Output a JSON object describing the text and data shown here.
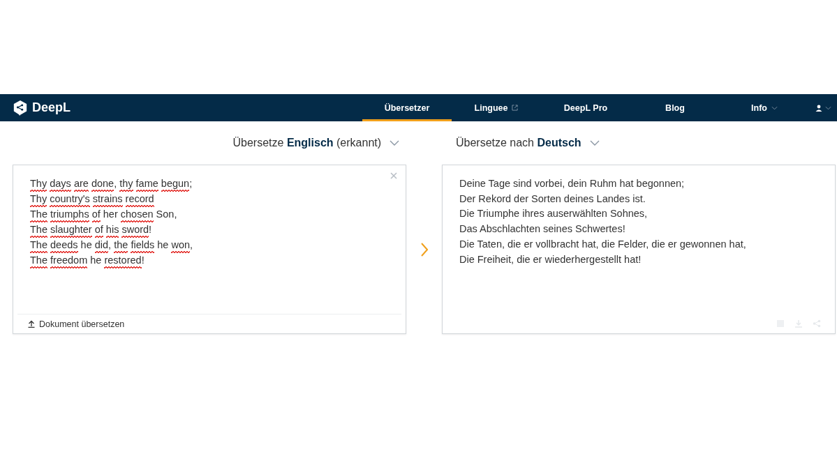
{
  "navbar": {
    "logo": "DeepL",
    "items": [
      {
        "label": "Übersetzer",
        "selected": true,
        "kind": "plain"
      },
      {
        "label": "Linguee",
        "selected": false,
        "kind": "external"
      },
      {
        "label": "DeepL Pro",
        "selected": false,
        "kind": "plain"
      },
      {
        "label": "Blog",
        "selected": false,
        "kind": "plain"
      },
      {
        "label": "Info",
        "selected": false,
        "kind": "dropdown"
      }
    ]
  },
  "source": {
    "header": "Übersetze **Englisch** (erkannt)",
    "lines": [
      [
        {
          "text": "Thy",
          "flagged": true
        },
        {
          "text": "days",
          "flagged": true
        },
        {
          "text": "are",
          "flagged": true
        },
        {
          "text": "done",
          "flagged": true,
          "after": ","
        },
        {
          "text": "thy",
          "flagged": true
        },
        {
          "text": "fame",
          "flagged": true
        },
        {
          "text": "begun",
          "flagged": true,
          "after": ";"
        }
      ],
      [
        {
          "text": "Thy",
          "flagged": true
        },
        {
          "text": "country's",
          "flagged": true
        },
        {
          "text": "strains",
          "flagged": true
        },
        {
          "text": "record",
          "flagged": true
        }
      ],
      [
        {
          "text": "The",
          "flagged": true
        },
        {
          "text": "triumphs",
          "flagged": true
        },
        {
          "text": "of",
          "flagged": true
        },
        {
          "text": "her",
          "flagged": false
        },
        {
          "text": "chosen",
          "flagged": true
        },
        {
          "text": "Son,",
          "flagged": false
        }
      ],
      [
        {
          "text": "The",
          "flagged": true
        },
        {
          "text": "slaughter",
          "flagged": true
        },
        {
          "text": "of",
          "flagged": true
        },
        {
          "text": "his",
          "flagged": true
        },
        {
          "text": "sword",
          "flagged": true,
          "after": "!"
        }
      ],
      [
        {
          "text": "The",
          "flagged": true
        },
        {
          "text": "deeds",
          "flagged": true
        },
        {
          "text": "he",
          "flagged": false
        },
        {
          "text": "did",
          "flagged": true,
          "after": ","
        },
        {
          "text": "the",
          "flagged": true
        },
        {
          "text": "fields",
          "flagged": true
        },
        {
          "text": "he",
          "flagged": false
        },
        {
          "text": "won",
          "flagged": true,
          "after": ","
        }
      ],
      [
        {
          "text": "The",
          "flagged": true
        },
        {
          "text": "freedom",
          "flagged": true
        },
        {
          "text": "he",
          "flagged": false
        },
        {
          "text": "restored",
          "flagged": true,
          "after": "!"
        }
      ]
    ],
    "upload_label": "Dokument übersetzen"
  },
  "target": {
    "header": "Übersetze nach **Deutsch**",
    "lines": [
      "Deine Tage sind vorbei, dein Ruhm hat begonnen;",
      "Der Rekord der Sorten deines Landes ist.",
      "Die Triumphe ihres auserwählten Sohnes,",
      "Das Abschlachten seines Schwertes!",
      "Die Taten, die er vollbracht hat, die Felder, die er gewonnen hat,",
      "Die Freiheit, die er wiederhergestellt hat!"
    ]
  }
}
